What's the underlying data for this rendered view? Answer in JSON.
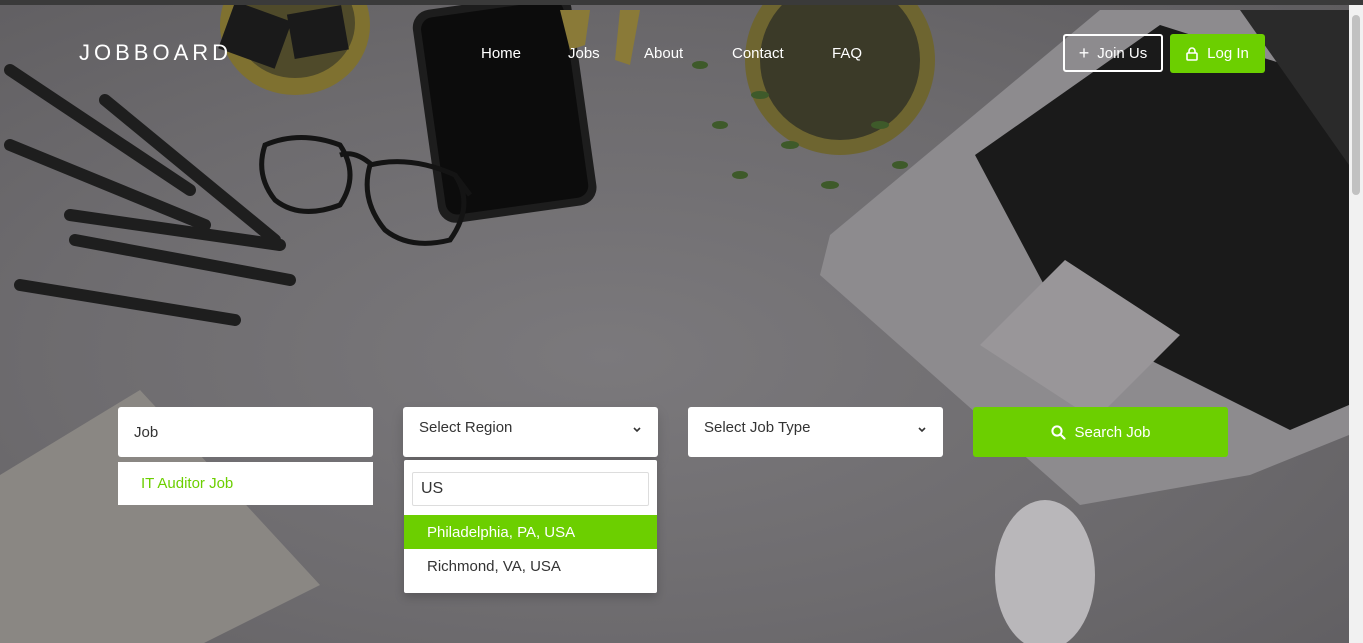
{
  "header": {
    "logo": "JOBBOARD",
    "nav": [
      "Home",
      "Jobs",
      "About",
      "Contact",
      "FAQ"
    ],
    "join_label": "Join Us",
    "login_label": "Log In"
  },
  "search": {
    "job_value": "Job",
    "region_label": "Select Region",
    "jobtype_label": "Select Job Type",
    "search_label": "Search Job",
    "job_suggestion": "IT Auditor Job",
    "region_dropdown": {
      "query": "US",
      "options": [
        "Philadelphia, PA, USA",
        "Richmond, VA, USA"
      ]
    }
  },
  "colors": {
    "accent": "#6ccf00"
  },
  "icons": [
    "plus-icon",
    "lock-icon",
    "search-icon",
    "chevron-down-icon"
  ]
}
